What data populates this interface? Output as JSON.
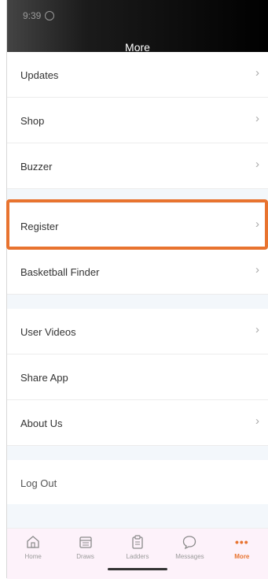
{
  "status": {
    "time": "9:39",
    "right": ""
  },
  "header": {
    "title": "More"
  },
  "menu": [
    {
      "label": "Updates",
      "chevron": true
    },
    {
      "label": "Shop",
      "chevron": true
    },
    {
      "label": "Buzzer",
      "chevron": true
    },
    {
      "label": "Register",
      "chevron": true
    },
    {
      "label": "Basketball Finder",
      "chevron": true
    },
    {
      "label": "User Videos",
      "chevron": true
    },
    {
      "label": "Share App",
      "chevron": false
    },
    {
      "label": "About Us",
      "chevron": true
    },
    {
      "label": "Log Out",
      "chevron": false
    }
  ],
  "chevron_glyph": "›",
  "tabs": [
    {
      "label": "Home",
      "icon": "home-icon"
    },
    {
      "label": "Draws",
      "icon": "calendar-icon"
    },
    {
      "label": "Ladders",
      "icon": "clipboard-icon"
    },
    {
      "label": "Messages",
      "icon": "chat-bubble-icon"
    },
    {
      "label": "More",
      "icon": "more-dots-icon",
      "active": true
    }
  ],
  "more_icon_glyph": "•••",
  "colors": {
    "accent": "#e8732f",
    "highlight": "#e8732f"
  }
}
